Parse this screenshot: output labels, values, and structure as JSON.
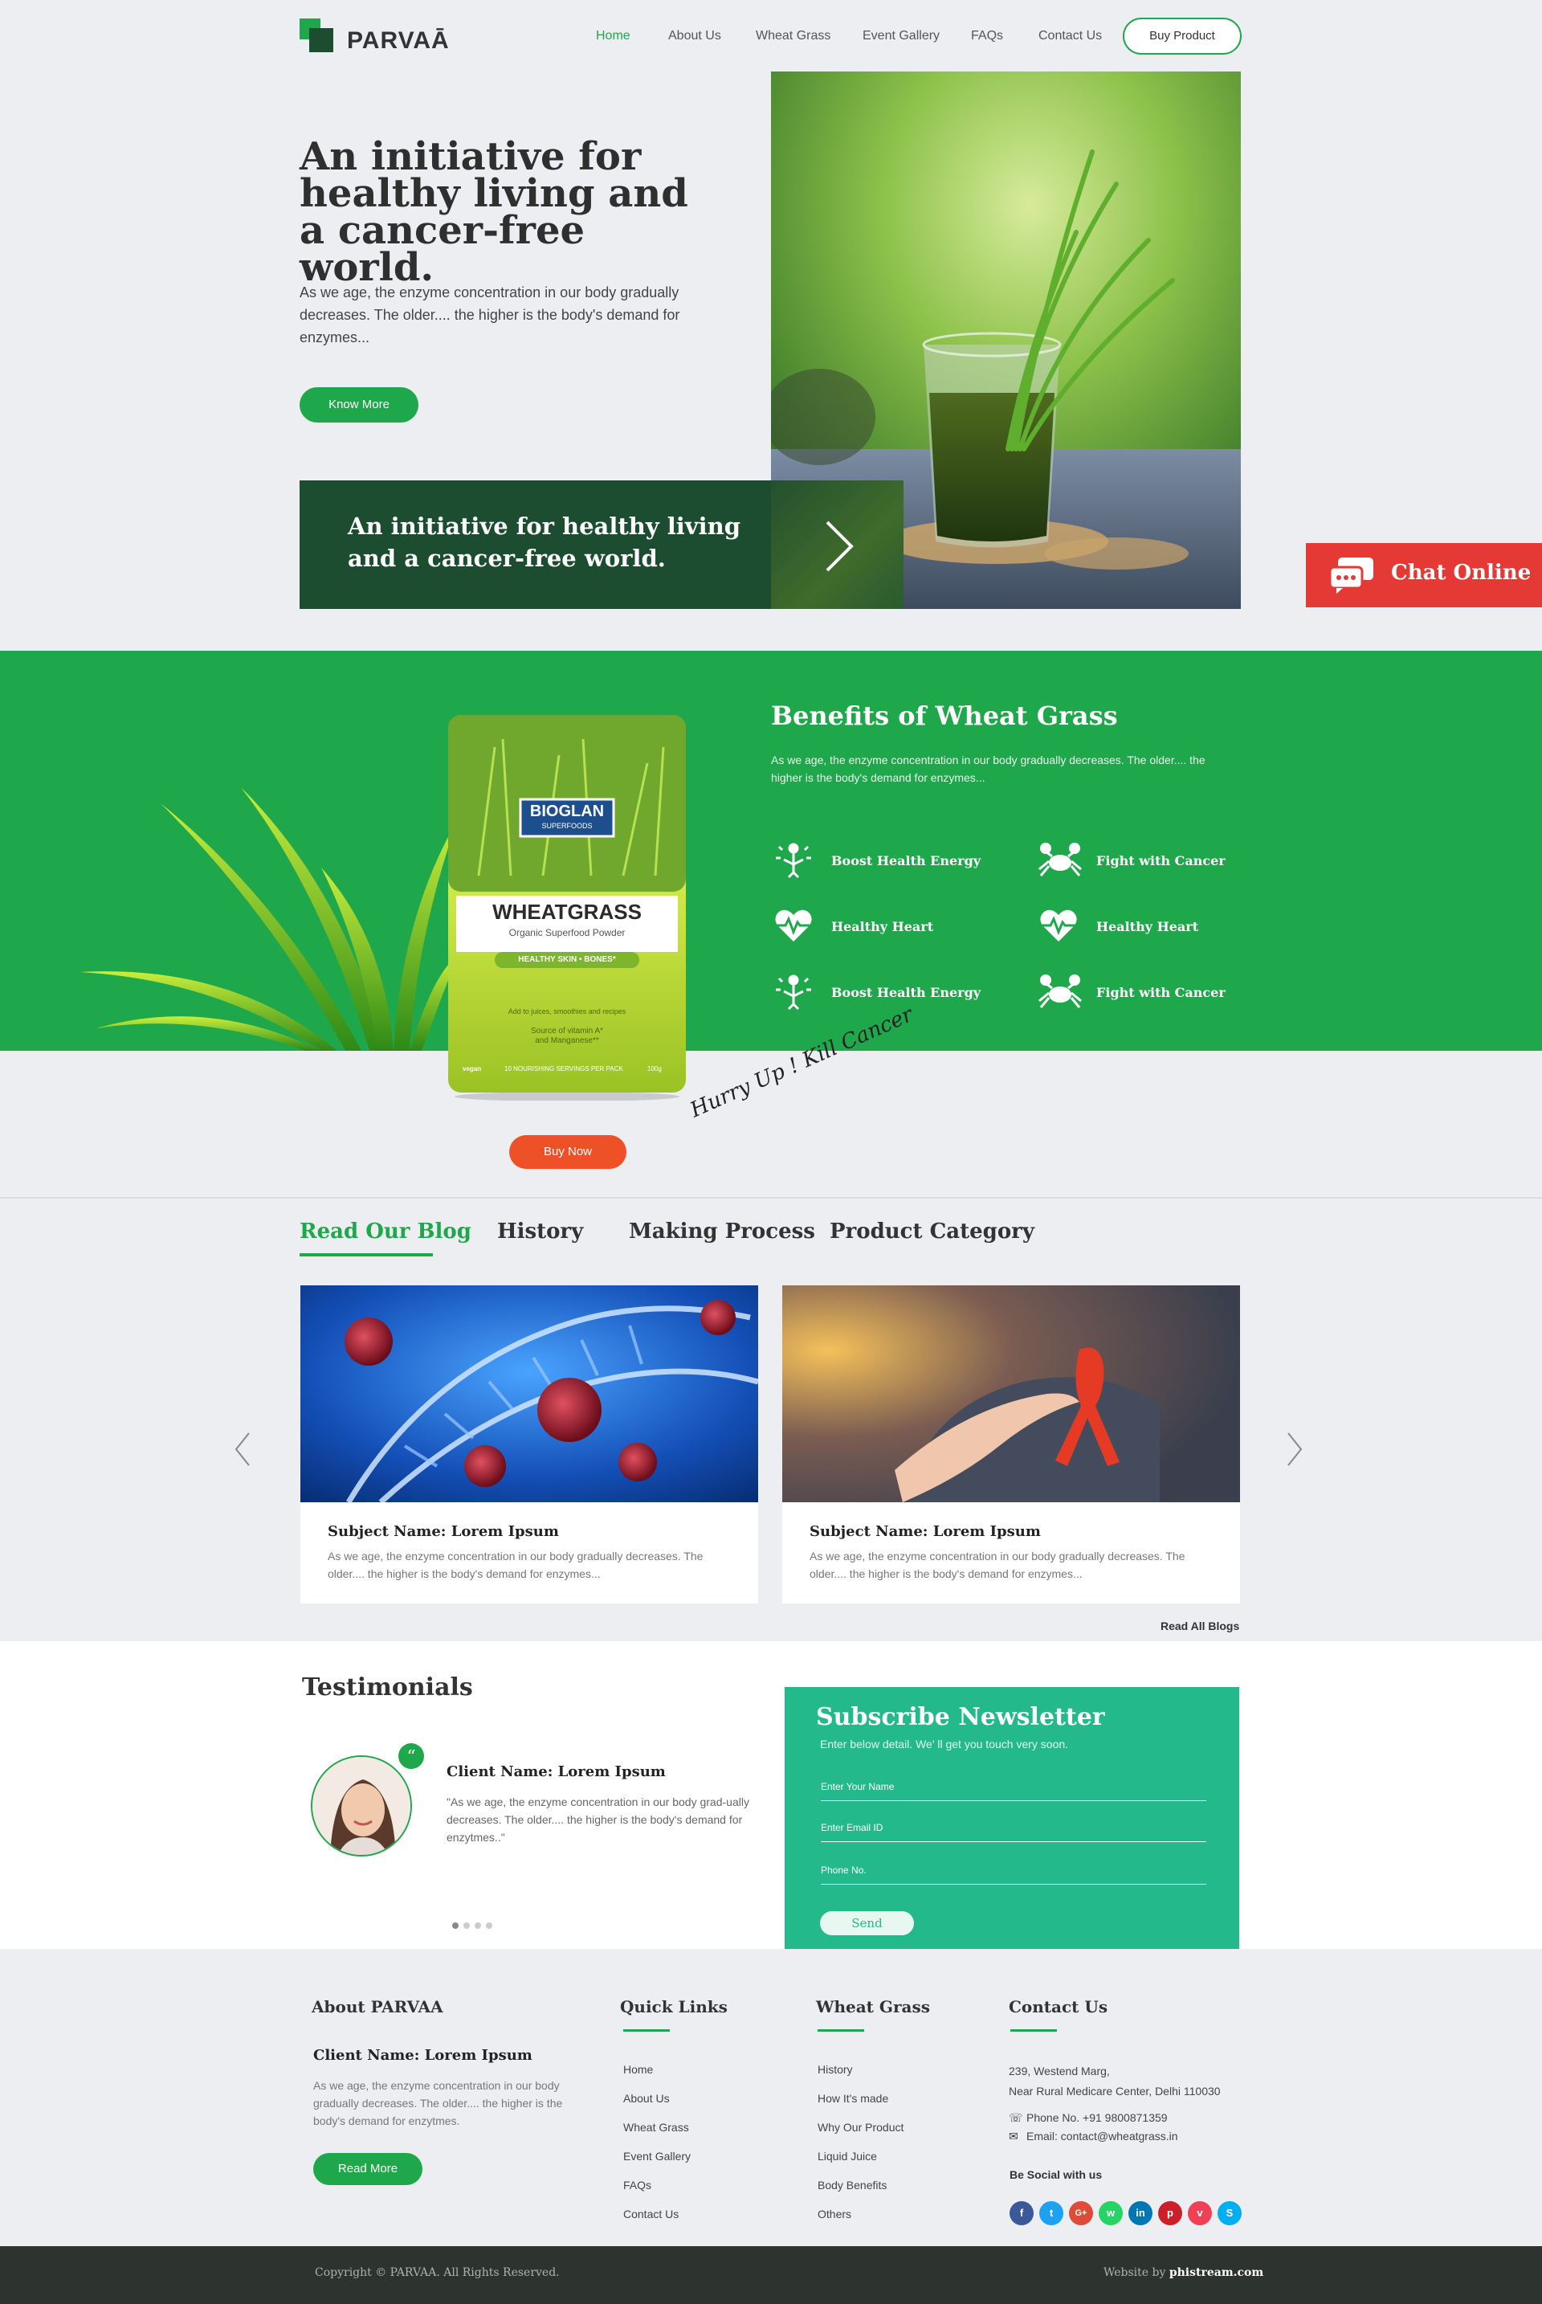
{
  "header": {
    "logo_text": "PARVAĀ",
    "nav": [
      "Home",
      "About Us",
      "Wheat Grass",
      "Event Gallery",
      "FAQs",
      "Contact Us"
    ],
    "active_nav": "Home",
    "buy_product": "Buy Product"
  },
  "hero": {
    "title": "An initiative for healthy living and a cancer-free world.",
    "text": "As we age, the enzyme  concentration in our body gradually decreases. The older.... the higher is the body's demand for enzymes...",
    "button": "Know More",
    "band_text": "An initiative for healthy living and a cancer-free world."
  },
  "chat": {
    "label": "Chat Online"
  },
  "benefits": {
    "title": "Benefits of Wheat Grass",
    "text": "As we age, the enzyme  concentration in our body gradually decreases. The older.... the higher is the body's demand for enzymes...",
    "items": [
      {
        "label": "Boost Health Energy",
        "icon": "energy-icon"
      },
      {
        "label": "Fight with Cancer",
        "icon": "crab-icon"
      },
      {
        "label": "Healthy Heart",
        "icon": "heart-icon"
      },
      {
        "label": "Healthy Heart",
        "icon": "heart-icon"
      },
      {
        "label": "Boost Health Energy",
        "icon": "energy-icon"
      },
      {
        "label": "Fight with Cancer",
        "icon": "crab-icon"
      }
    ],
    "pack": {
      "brand": "BIOGLAN",
      "brand_sub": "SUPERFOODS",
      "product": "WHEATGRASS",
      "product_sub": "Organic Superfood Powder",
      "badge": "HEALTHY SKIN • BONES*",
      "line1": "Add to juices, smoothies and recipes",
      "line2": "Source of vitamin A*",
      "line3": "and Manganese**",
      "line4": "10 NOURISHING SERVINGS PER PACK",
      "weight": "100g",
      "vegan": "vegan"
    },
    "buy_now": "Buy Now",
    "tagline": "Hurry Up ! Kill Cancer"
  },
  "blog": {
    "tabs": [
      "Read Our Blog",
      "History",
      "Making Process",
      "Product Category"
    ],
    "active_tab": "Read Our Blog",
    "cards": [
      {
        "subject": "Subject Name: Lorem Ipsum",
        "text": "As we age, the enzyme  concentration in our body gradually decreases. The older.... the higher is the body's demand for enzymes..."
      },
      {
        "subject": "Subject Name: Lorem Ipsum",
        "text": "As we age, the enzyme  concentration in our body gradually decreases. The older.... the higher is the body's demand for enzymes..."
      }
    ],
    "read_all": "Read All Blogs"
  },
  "testimonials": {
    "title": "Testimonials",
    "client_name": "Client Name: Lorem Ipsum",
    "quote": "\"As we age, the enzyme  concentration in our body grad-ually decreases. The older.... the higher is the body's demand for enzytmes..\"",
    "dots": 4,
    "active_dot": 1
  },
  "newsletter": {
    "title": "Subscribe Newsletter",
    "subtitle": "Enter below detail. We' ll get you touch very soon.",
    "name_placeholder": "Enter Your Name",
    "email_placeholder": "Enter Email ID",
    "phone_placeholder": "Phone No.",
    "send": "Send"
  },
  "footer": {
    "about": {
      "heading": "About PARVAA",
      "name": "Client Name: Lorem Ipsum",
      "text": "As we age, the enzyme  concentration in our body gradually decreases. The older.... the higher is the body's demand for enzytmes.",
      "button": "Read More"
    },
    "quick_links": {
      "heading": "Quick Links",
      "items": [
        "Home",
        "About Us",
        "Wheat Grass",
        "Event Gallery",
        "FAQs",
        "Contact Us"
      ]
    },
    "wheat_grass": {
      "heading": "Wheat Grass",
      "items": [
        "History",
        "How It's made",
        "Why Our Product",
        "Liquid Juice",
        "Body Benefits",
        "Others"
      ]
    },
    "contact": {
      "heading": "Contact Us",
      "address1": "239, Westend Marg,",
      "address2": "Near Rural Medicare Center, Delhi 110030",
      "phone": "Phone No. +91 9800871359",
      "email": "Email: contact@wheatgrass.in",
      "social_heading": "Be Social with us",
      "social": [
        {
          "name": "facebook-icon",
          "glyph": "f",
          "color": "#3b5998"
        },
        {
          "name": "twitter-icon",
          "glyph": "t",
          "color": "#1da1f2"
        },
        {
          "name": "google-plus-icon",
          "glyph": "G+",
          "color": "#dd4b39"
        },
        {
          "name": "whatsapp-icon",
          "glyph": "w",
          "color": "#25d366"
        },
        {
          "name": "linkedin-icon",
          "glyph": "in",
          "color": "#0077b5"
        },
        {
          "name": "pinterest-icon",
          "glyph": "p",
          "color": "#cb2027"
        },
        {
          "name": "pocket-icon",
          "glyph": "v",
          "color": "#ef4056"
        },
        {
          "name": "skype-icon",
          "glyph": "S",
          "color": "#00aff0"
        }
      ]
    },
    "copyright": "Copyright © PARVAA. All Rights Reserved.",
    "website_by_label": "Website by ",
    "website_by": "phistream.com"
  },
  "colors": {
    "brand_green": "#1fa74b",
    "dark_green": "#1d4d31",
    "teal": "#23b98b",
    "chat_red": "#e53935",
    "buy_orange": "#ef5126",
    "footer_dark": "#2d332f"
  }
}
